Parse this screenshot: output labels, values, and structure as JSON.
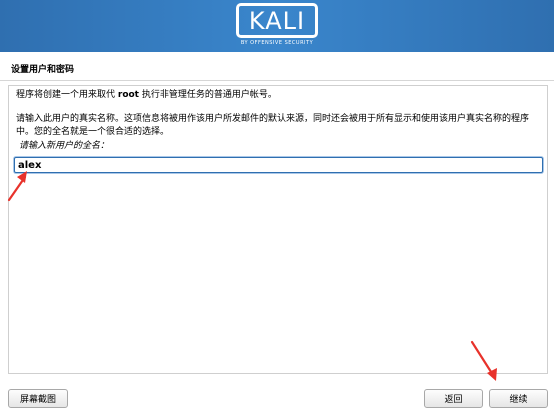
{
  "banner": {
    "logo_text": "KALI",
    "logo_tagline": "BY OFFENSIVE SECURITY"
  },
  "page": {
    "title": "设置用户和密码"
  },
  "content": {
    "para1_prefix": "程序将创建一个用来取代 ",
    "para1_root": "root",
    "para1_suffix": " 执行非管理任务的普通用户帐号。",
    "para2": "请输入此用户的真实名称。这项信息将被用作该用户所发邮件的默认来源，同时还会被用于所有显示和使用该用户真实名称的程序中。您的全名就是一个很合适的选择。",
    "prompt": "请输入新用户的全名：",
    "fullname_value": "alex"
  },
  "buttons": {
    "screenshot": "屏幕截图",
    "back": "返回",
    "continue": "继续"
  },
  "colors": {
    "banner": "#3a86cc",
    "annotation_arrow": "#e8322b"
  },
  "icons": {
    "annotation_arrow": "arrow-icon"
  }
}
